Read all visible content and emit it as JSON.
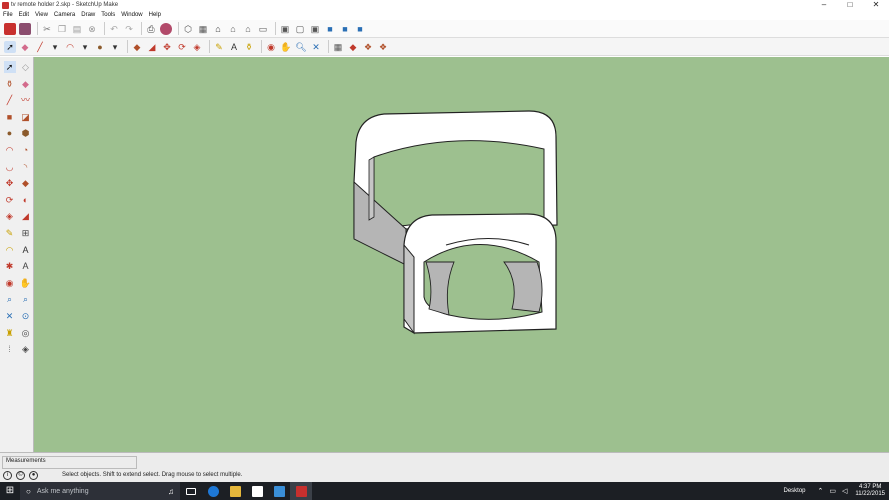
{
  "window": {
    "title": "tv remote holder 2.skp - SketchUp Make",
    "controls": [
      "–",
      "□",
      "✕"
    ]
  },
  "menu": [
    "File",
    "Edit",
    "View",
    "Camera",
    "Draw",
    "Tools",
    "Window",
    "Help"
  ],
  "toolbar1": [
    "3d-warehouse-icon",
    "extension-icon",
    "cut-icon",
    "copy-icon",
    "paste-icon",
    "erase-icon",
    "undo-icon",
    "redo-icon",
    "print-icon",
    "model-info-icon",
    "iso-view-icon",
    "top-view-icon",
    "front-view-icon",
    "right-view-icon",
    "back-view-icon",
    "left-view-icon",
    "xray-icon",
    "wireframe-icon",
    "hidden-line-icon",
    "shaded-icon",
    "shaded-texture-icon",
    "monochrome-icon"
  ],
  "toolbar2": [
    "select-icon",
    "eraser-icon",
    "line-icon",
    "arc-icon",
    "rectangle-icon",
    "push-pull-icon",
    "offset-icon",
    "move-icon",
    "rotate-icon",
    "scale-icon",
    "tape-measure-icon",
    "text-icon",
    "paint-bucket-icon",
    "orbit-icon",
    "pan-icon",
    "zoom-icon",
    "zoom-extents-icon",
    "warehouse-icon",
    "extension-warehouse-icon",
    "components-icon",
    "styles-icon"
  ],
  "sidebar": [
    "select-icon",
    "make-component-icon",
    "paint-bucket-icon",
    "eraser-icon",
    "line-icon",
    "freehand-icon",
    "rectangle-icon",
    "rotated-rect-icon",
    "circle-icon",
    "polygon-icon",
    "arc-icon",
    "pie-icon",
    "three-point-arc-icon",
    "two-point-arc-icon",
    "move-icon",
    "push-pull-icon",
    "rotate-icon",
    "follow-me-icon",
    "scale-icon",
    "offset-icon",
    "tape-measure-icon",
    "dimension-icon",
    "protractor-icon",
    "text-icon",
    "axes-icon",
    "3d-text-icon",
    "orbit-icon",
    "pan-icon",
    "zoom-icon",
    "zoom-window-icon",
    "zoom-extents-icon",
    "previous-icon",
    "position-camera-icon",
    "look-around-icon",
    "walk-icon",
    "section-plane-icon"
  ],
  "status": {
    "measurements_label": "Measurements",
    "hint": "Select objects. Shift to extend select. Drag mouse to select multiple."
  },
  "taskbar": {
    "search_placeholder": "Ask me anything",
    "desktop_label": "Desktop",
    "time": "4:37 PM",
    "date": "11/22/2015"
  },
  "colors": {
    "viewport_bg": "#9dc08f",
    "model_face": "#ffffff",
    "model_shade": "#b5b5b5",
    "taskbar": "#1c1f24"
  }
}
